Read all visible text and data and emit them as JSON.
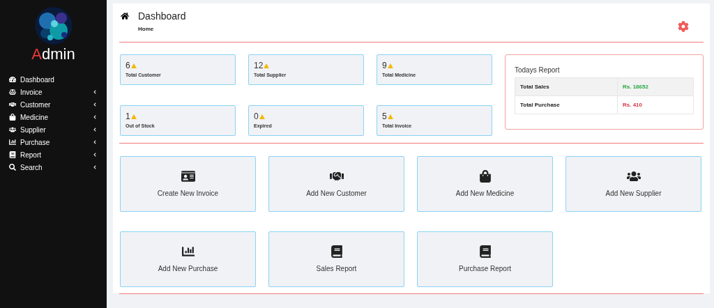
{
  "sidebar": {
    "brand": {
      "accent": "A",
      "rest": "dmin"
    },
    "items": [
      {
        "label": "Dashboard",
        "expandable": false
      },
      {
        "label": "Invoice",
        "expandable": true
      },
      {
        "label": "Customer",
        "expandable": true
      },
      {
        "label": "Medicine",
        "expandable": true
      },
      {
        "label": "Supplier",
        "expandable": true
      },
      {
        "label": "Purchase",
        "expandable": true
      },
      {
        "label": "Report",
        "expandable": true
      },
      {
        "label": "Search",
        "expandable": true
      }
    ]
  },
  "header": {
    "title": "Dashboard",
    "breadcrumb": "Home"
  },
  "stats": [
    {
      "value": "6",
      "label": "Total Customer"
    },
    {
      "value": "12",
      "label": "Total Supplier"
    },
    {
      "value": "9",
      "label": "Total Medicine"
    },
    {
      "value": "1",
      "label": "Out of Stock"
    },
    {
      "value": "0",
      "label": "Expired"
    },
    {
      "value": "5",
      "label": "Total Invoice"
    }
  ],
  "report": {
    "title": "Todays Report",
    "rows": [
      {
        "label": "Total Sales",
        "value": "Rs. 18652",
        "color": "#28a745"
      },
      {
        "label": "Total Purchase",
        "value": "Rs. 410",
        "color": "#dc3545"
      }
    ]
  },
  "actions": [
    {
      "label": "Create New Invoice"
    },
    {
      "label": "Add New Customer"
    },
    {
      "label": "Add New Medicine"
    },
    {
      "label": "Add New Supplier"
    },
    {
      "label": "Add New Purchase"
    },
    {
      "label": "Sales Report"
    },
    {
      "label": "Purchase Report"
    }
  ]
}
